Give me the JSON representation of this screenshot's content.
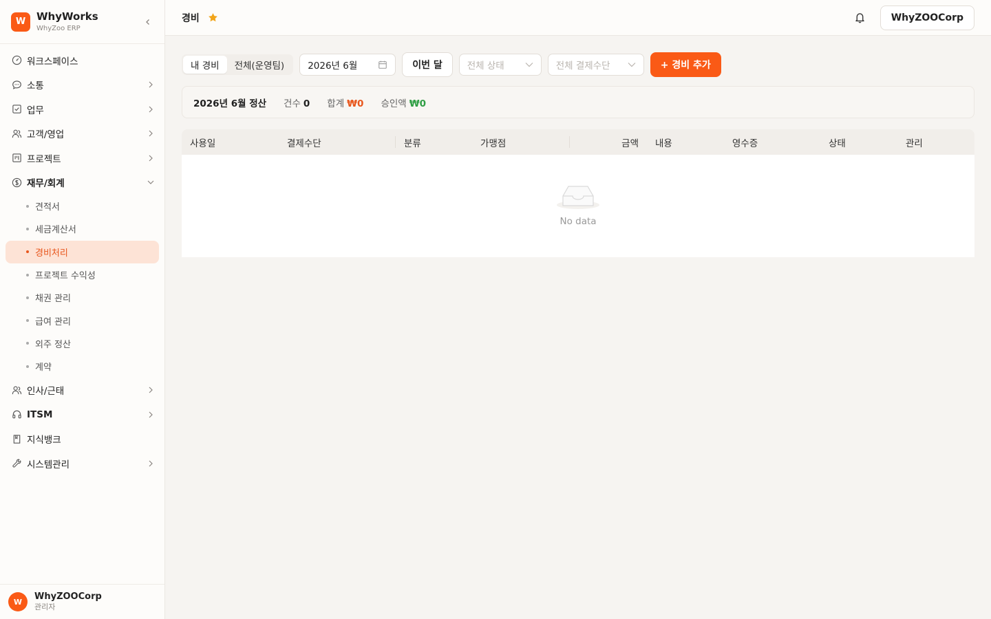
{
  "brand": {
    "name": "WhyWorks",
    "subtitle": "WhyZoo ERP",
    "logo_letter": "W"
  },
  "sidebar": {
    "items": [
      {
        "label": "워크스페이스",
        "icon": "dashboard-icon",
        "has_children": false
      },
      {
        "label": "소통",
        "icon": "chat-icon",
        "has_children": true
      },
      {
        "label": "업무",
        "icon": "checkbox-icon",
        "has_children": true
      },
      {
        "label": "고객/영업",
        "icon": "users-icon",
        "has_children": true
      },
      {
        "label": "프로젝트",
        "icon": "kanban-icon",
        "has_children": true
      },
      {
        "label": "재무/회계",
        "icon": "dollar-icon",
        "has_children": true,
        "expanded": true
      },
      {
        "label": "인사/근태",
        "icon": "people-icon",
        "has_children": true
      },
      {
        "label": "ITSM",
        "icon": "headset-icon",
        "has_children": true
      },
      {
        "label": "지식뱅크",
        "icon": "book-icon",
        "has_children": false
      },
      {
        "label": "시스템관리",
        "icon": "wrench-icon",
        "has_children": true
      }
    ],
    "finance_sub": [
      "견적서",
      "세금계산서",
      "경비처리",
      "프로젝트 수익성",
      "채권 관리",
      "급여 관리",
      "외주 정산",
      "계약"
    ],
    "active_sub": "경비처리"
  },
  "user": {
    "name": "WhyZOOCorp",
    "role": "관리자",
    "avatar_letter": "W"
  },
  "header": {
    "title": "경비",
    "org_button": "WhyZOOCorp"
  },
  "toolbar": {
    "tab_mine": "내 경비",
    "tab_all": "전체(운영팀)",
    "month_value": "2026년 6월",
    "this_month": "이번 달",
    "status_placeholder": "전체 상태",
    "payment_placeholder": "전체 결제수단",
    "add_button": "+ 경비 추가"
  },
  "summary": {
    "period": "2026년 6월 정산",
    "count_label": "건수",
    "count_value": "0",
    "total_label": "합계",
    "total_value": "₩0",
    "approved_label": "승인액",
    "approved_value": "₩0"
  },
  "table": {
    "columns": [
      "사용일",
      "결제수단",
      "분류",
      "가맹점",
      "금액",
      "내용",
      "영수증",
      "상태",
      "관리"
    ],
    "rows": [],
    "empty_text": "No data"
  },
  "colors": {
    "accent": "#fa5a16",
    "active_bg": "#fde3d6",
    "star": "#f2a51a",
    "approved": "#2f9e44"
  }
}
